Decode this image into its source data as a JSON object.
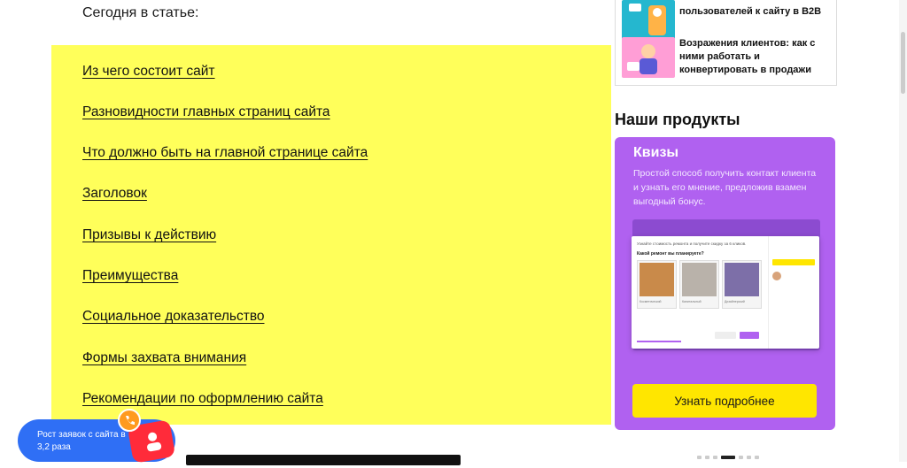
{
  "intro": "Сегодня в статье:",
  "toc": [
    "Из чего состоит сайт ",
    "Разновидности главных страниц сайта ",
    "Что должно быть на главной странице сайта ",
    "Заголовок ",
    "Призывы к действию ",
    "Преимущества ",
    "Социальное доказательство ",
    "Формы захвата внимания ",
    "Рекомендации по оформлению сайта "
  ],
  "articles": [
    {
      "title": "пользователей к сайту в B2B"
    },
    {
      "title": "Возражения клиентов: как с ними работать и конвертировать в продажи"
    }
  ],
  "products_heading": "Наши продукты",
  "card": {
    "title": "Квизы",
    "desc": "Простой способ получить контакт клиента и узнать его мнение, предложив взамен выгодный бонус.",
    "cta": "Узнать подробнее",
    "mock": {
      "question_small": "Узнайте стоимость ремонта и получите скидку за 6 кликов.",
      "question": "Какой ремонт вы планируете?",
      "options": [
        "Косметический",
        "Капитальный",
        "Дизайнерский"
      ]
    }
  },
  "promo": {
    "text": "Рост заявок с сайта в 3,2 раза"
  },
  "colors": {
    "toc_bg": "#ffff5a",
    "card_bg": "#b061f0",
    "cta_bg": "#ffe600",
    "promo_bg": "#2f6ff5",
    "badge": "#ff2b3a"
  }
}
